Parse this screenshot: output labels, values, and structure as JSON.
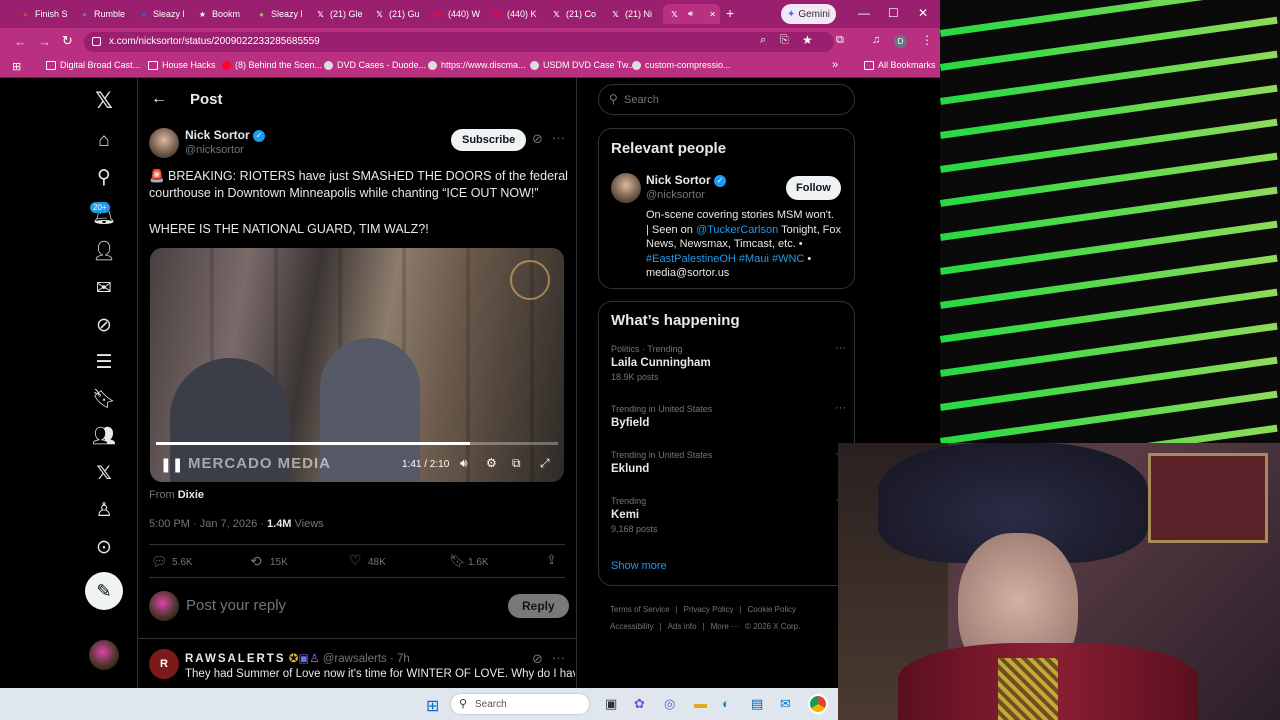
{
  "browser": {
    "tabs": [
      {
        "label": "Finish S",
        "icon": "musescore-icon",
        "color": "#e03b3b"
      },
      {
        "label": "Rumble",
        "icon": "rumble-icon",
        "color": "#3b82f6"
      },
      {
        "label": "Sleazy l",
        "icon": "bookmark-app-icon",
        "color": "#2563eb"
      },
      {
        "label": "Bookm",
        "icon": "star-icon",
        "color": "#ffffff"
      },
      {
        "label": "Sleazy l",
        "icon": "rumble-play-icon",
        "color": "#85c742"
      },
      {
        "label": "(21) Gle",
        "icon": "x-logo-icon",
        "color": "#ffffff"
      },
      {
        "label": "(21) Gu",
        "icon": "x-logo-icon",
        "color": "#ffffff"
      },
      {
        "label": "(440) W",
        "icon": "youtube-icon",
        "color": "#ff0033"
      },
      {
        "label": "(440) K",
        "icon": "youtube-icon",
        "color": "#ff0033"
      },
      {
        "label": "(21) Co",
        "icon": "x-logo-icon",
        "color": "#ffffff"
      },
      {
        "label": "(21) Ni",
        "icon": "x-logo-icon",
        "color": "#ffffff"
      },
      {
        "label": "",
        "icon": "x-logo-icon",
        "color": "#ffffff"
      }
    ],
    "gemini_label": "Gemini",
    "url": "x.com/nicksortor/status/2009022233285685559",
    "bookmarks": [
      {
        "label": "Digital Broad Cast...",
        "icon": "folder-icon"
      },
      {
        "label": "House Hacks",
        "icon": "folder-icon"
      },
      {
        "label": "(8) Behind the Scen...",
        "icon": "youtube-icon"
      },
      {
        "label": "DVD Cases - Duode...",
        "icon": "site-icon"
      },
      {
        "label": "https://www.discma...",
        "icon": "site-icon"
      },
      {
        "label": "USDM DVD Case Tw...",
        "icon": "site-icon"
      },
      {
        "label": "custom-compressio...",
        "icon": "site-icon"
      }
    ],
    "all_bookmarks": "All Bookmarks"
  },
  "nav": {
    "notifications_badge": "20+"
  },
  "post": {
    "header": "Post",
    "author_name": "Nick Sortor",
    "author_handle": "@nicksortor",
    "subscribe_label": "Subscribe",
    "text_line1": "🚨 BREAKING: RIOTERS have just SMASHED THE DOORS of the federal courthouse in Downtown Minneapolis while chanting “ICE OUT NOW!”",
    "text_line2": "WHERE IS THE NATIONAL GUARD, TIM WALZ?!",
    "video": {
      "watermark": "MERCADO MEDIA",
      "time": "1:41 / 2:10",
      "progress": 0.78
    },
    "from_label": "From",
    "from_name": "Dixie",
    "timestamp": "5:00 PM · Jan 7, 2026 · ",
    "views_count": "1.4M",
    "views_label": " Views",
    "replies": "5.6K",
    "reposts": "15K",
    "likes": "48K",
    "bookmarks": "1.6K",
    "reply_placeholder": "Post your reply",
    "reply_button": "Reply"
  },
  "reply": {
    "name": "RAWSALERTS",
    "handle": "@rawsalerts",
    "age": "· 7h",
    "text": "They had Summer of Love now it's time for WINTER OF LOVE. Why do I have"
  },
  "sidebar": {
    "search_placeholder": "Search",
    "relevant_title": "Relevant people",
    "person_name": "Nick Sortor",
    "person_handle": "@nicksortor",
    "follow_label": "Follow",
    "bio_1": "On-scene covering stories MSM won't.",
    "bio_2": "| Seen on ",
    "bio_link1": "@TuckerCarlson",
    "bio_3": " Tonight, Fox",
    "bio_4": "News, Newsmax, Timcast, etc. •",
    "bio_link2": "#EastPalestineOH #Maui #WNC",
    "bio_5": " •",
    "bio_6": "media@sortor.us",
    "happening_title": "What’s happening",
    "trends": [
      {
        "context": "Politics · Trending",
        "name": "Laila Cunningham",
        "count": "18.9K posts"
      },
      {
        "context": "Trending in United States",
        "name": "Byfield",
        "count": ""
      },
      {
        "context": "Trending in United States",
        "name": "Eklund",
        "count": ""
      },
      {
        "context": "Trending",
        "name": "Kemi",
        "count": "9,168 posts"
      }
    ],
    "show_more": "Show more",
    "footer": [
      "Terms of Service",
      "Privacy Policy",
      "Cookie Policy",
      "Accessibility",
      "Ads info",
      "More ···",
      "© 2026 X Corp."
    ]
  },
  "taskbar": {
    "search_placeholder": "Search"
  }
}
